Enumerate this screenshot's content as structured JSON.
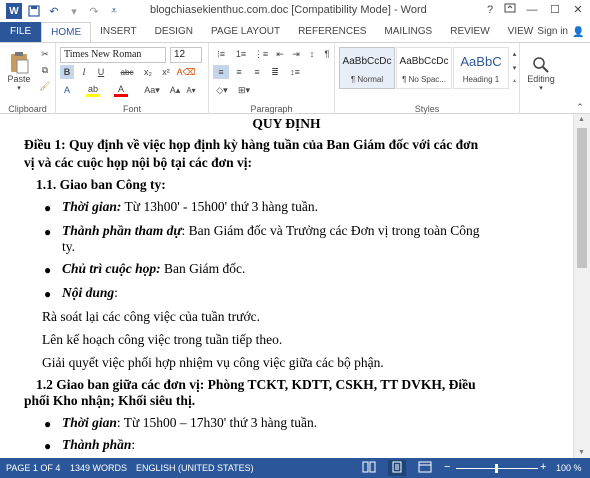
{
  "titlebar": {
    "title": "blogchiasekienthuc.com.doc [Compatibility Mode] - Word",
    "help": "?",
    "minimize": "—",
    "restore": "☐",
    "close": "✕"
  },
  "tabs": [
    "FILE",
    "HOME",
    "INSERT",
    "DESIGN",
    "PAGE LAYOUT",
    "REFERENCES",
    "MAILINGS",
    "REVIEW",
    "VIEW"
  ],
  "signin": "Sign in",
  "ribbon": {
    "clipboard": {
      "paste": "Paste",
      "label": "Clipboard"
    },
    "font": {
      "name": "Times New Roman",
      "size": "12",
      "label": "Font"
    },
    "paragraph": {
      "label": "Paragraph"
    },
    "styles": {
      "label": "Styles",
      "items": [
        {
          "sample": "AaBbCcDc",
          "name": "¶ Normal"
        },
        {
          "sample": "AaBbCcDc",
          "name": "¶ No Spac..."
        },
        {
          "sample": "AaBbC",
          "name": "Heading 1"
        }
      ]
    },
    "editing": {
      "label": "Editing"
    }
  },
  "document": {
    "title": "QUY ĐỊNH",
    "dieu1_line1": "Điều 1: Quy định về việc họp định kỳ hàng tuần của Ban Giám đốc với các đơn",
    "dieu1_line2": "vị và các cuộc họp nội bộ tại các đơn vị:",
    "s11": "1.1. Giao ban Công ty:",
    "b1_label": "Thời gian:",
    "b1_text": " Từ 13h00' - 15h00' thứ 3 hàng tuần.",
    "b2_label": "Thành phần tham dự",
    "b2_text": ": Ban Giám đốc và Trưởng các Đơn vị trong toàn Công",
    "b2_cont": "ty.",
    "b3_label": "Chủ trì cuộc họp:",
    "b3_text": " Ban Giám đốc.",
    "b4_label": "Nội dung",
    "b4_text": ":",
    "p1": "Rà soát lại các công việc của tuần trước.",
    "p2": "Lên kế hoạch công việc trong tuần tiếp theo.",
    "p3": "Giải quyết việc phối hợp nhiệm vụ công việc giữa các bộ phận.",
    "s12_line1": "1.2 Giao ban giữa các đơn vị: Phòng TCKT, KDTT, CSKH, TT DVKH, Điều",
    "s12_line2": "phối Kho nhận; Khối siêu thị.",
    "b5_label": "Thời gian",
    "b5_text": ": Từ 15h00 – 17h30' thứ 3 hàng tuần.",
    "b6_label": "Thành phần",
    "b6_text": ":"
  },
  "statusbar": {
    "page": "PAGE 1 OF 4",
    "words": "1349 WORDS",
    "language": "ENGLISH (UNITED STATES)",
    "zoom": "100 %"
  }
}
